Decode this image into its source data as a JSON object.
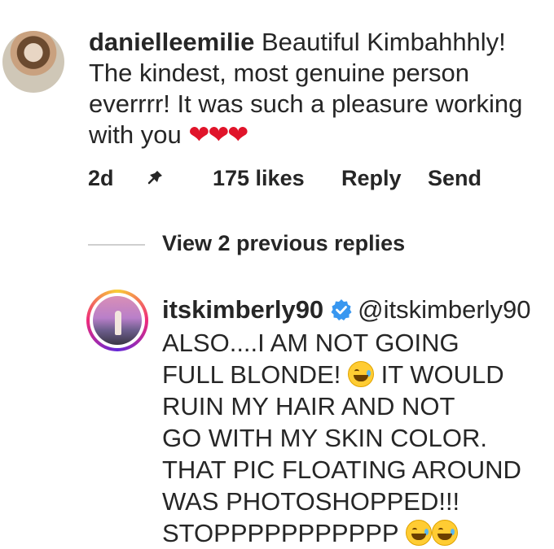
{
  "comment": {
    "username": "danielleemilie",
    "text": "Beautiful Kimbahhhly! The kindest, most genuine person everrrr! It was such a pleasure working with you",
    "hearts": "❤❤❤",
    "time": "2d",
    "likes": "175 likes",
    "reply_label": "Reply",
    "send_label": "Send"
  },
  "thread": {
    "view_replies": "View 2 previous replies"
  },
  "reply": {
    "username": "itskimberly90",
    "mention": "@itskimberly90",
    "lines": [
      "ALSO....I AM NOT GOING",
      "FULL BLONDE!",
      " IT WOULD",
      "RUIN MY HAIR AND NOT",
      "GO WITH MY SKIN COLOR.",
      "THAT PIC FLOATING AROUND",
      "WAS PHOTOSHOPPED!!!",
      "STOPPPPPPPPPPP"
    ]
  },
  "icons": {
    "pin": "pin-icon",
    "verified": "verified-badge-icon",
    "emoji": "laughing-tears-emoji-icon"
  },
  "colors": {
    "text": "#262626",
    "heart": "#e0142a",
    "verified": "#3897f0"
  }
}
